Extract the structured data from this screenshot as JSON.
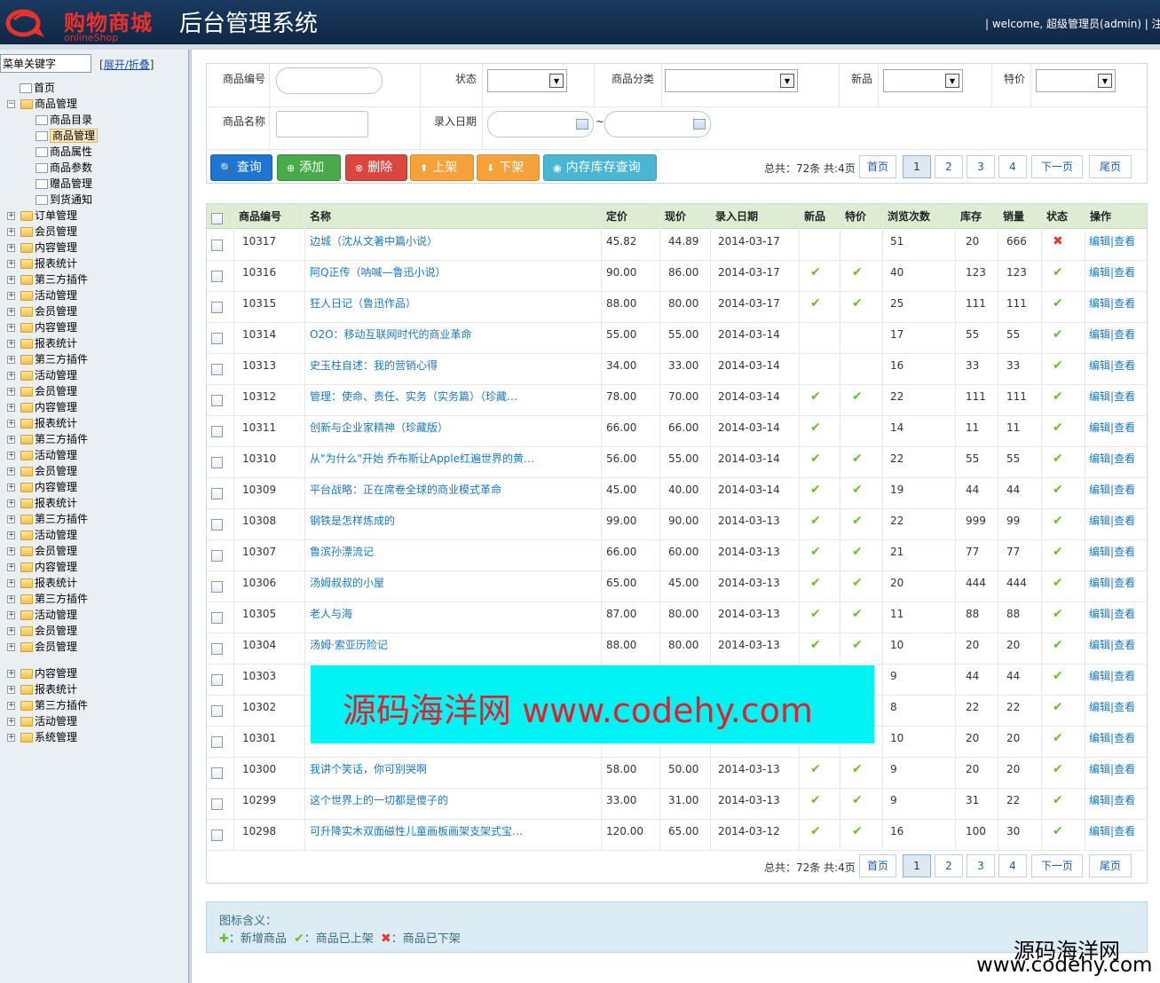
{
  "header": {
    "logo_text": "购物商城",
    "logo_sub": "onlineShop",
    "title": "后台管理系统",
    "welcome": "| welcome, 超级管理员(admin) | 注销"
  },
  "sidebar": {
    "search_value": "菜单关键字",
    "toggle_label": "展开/折叠",
    "items": [
      {
        "label": "首页",
        "type": "page",
        "level": 1
      },
      {
        "label": "商品管理",
        "type": "folder",
        "level": 0,
        "expanded": true
      },
      {
        "label": "商品目录",
        "type": "page",
        "level": 2
      },
      {
        "label": "商品管理",
        "type": "page",
        "level": 2,
        "selected": true
      },
      {
        "label": "商品属性",
        "type": "page",
        "level": 2
      },
      {
        "label": "商品参数",
        "type": "page",
        "level": 2
      },
      {
        "label": "赠品管理",
        "type": "page",
        "level": 2
      },
      {
        "label": "到货通知",
        "type": "page",
        "level": 2
      },
      {
        "label": "订单管理",
        "type": "folder",
        "level": 0
      },
      {
        "label": "会员管理",
        "type": "folder",
        "level": 0
      },
      {
        "label": "内容管理",
        "type": "folder",
        "level": 0
      },
      {
        "label": "报表统计",
        "type": "folder",
        "level": 0
      },
      {
        "label": "第三方插件",
        "type": "folder",
        "level": 0
      },
      {
        "label": "活动管理",
        "type": "folder",
        "level": 0
      },
      {
        "label": "会员管理",
        "type": "folder",
        "level": 0
      },
      {
        "label": "内容管理",
        "type": "folder",
        "level": 0
      },
      {
        "label": "报表统计",
        "type": "folder",
        "level": 0
      },
      {
        "label": "第三方插件",
        "type": "folder",
        "level": 0
      },
      {
        "label": "活动管理",
        "type": "folder",
        "level": 0
      },
      {
        "label": "会员管理",
        "type": "folder",
        "level": 0
      },
      {
        "label": "内容管理",
        "type": "folder",
        "level": 0
      },
      {
        "label": "报表统计",
        "type": "folder",
        "level": 0
      },
      {
        "label": "第三方插件",
        "type": "folder",
        "level": 0
      },
      {
        "label": "活动管理",
        "type": "folder",
        "level": 0
      },
      {
        "label": "会员管理",
        "type": "folder",
        "level": 0
      },
      {
        "label": "内容管理",
        "type": "folder",
        "level": 0
      },
      {
        "label": "报表统计",
        "type": "folder",
        "level": 0
      },
      {
        "label": "第三方插件",
        "type": "folder",
        "level": 0
      },
      {
        "label": "活动管理",
        "type": "folder",
        "level": 0
      },
      {
        "label": "会员管理",
        "type": "folder",
        "level": 0
      },
      {
        "label": "内容管理",
        "type": "folder",
        "level": 0
      },
      {
        "label": "报表统计",
        "type": "folder",
        "level": 0
      },
      {
        "label": "第三方插件",
        "type": "folder",
        "level": 0
      },
      {
        "label": "活动管理",
        "type": "folder",
        "level": 0
      },
      {
        "label": "会员管理",
        "type": "folder",
        "level": 0
      },
      {
        "label": "会员管理",
        "type": "folder",
        "level": 0
      },
      {
        "label": "内容管理",
        "type": "folder",
        "level": 0
      },
      {
        "label": "报表统计",
        "type": "folder",
        "level": 0
      },
      {
        "label": "第三方插件",
        "type": "folder",
        "level": 0
      },
      {
        "label": "活动管理",
        "type": "folder",
        "level": 0
      },
      {
        "label": "系统管理",
        "type": "folder",
        "level": 0
      }
    ]
  },
  "filter": {
    "code_label": "商品编号",
    "status_label": "状态",
    "category_label": "商品分类",
    "new_label": "新品",
    "special_label": "特价",
    "name_label": "商品名称",
    "date_label": "录入日期",
    "date_sep": "~"
  },
  "toolbar": {
    "query": "查询",
    "add": "添加",
    "delete": "删除",
    "shelf_up": "上架",
    "shelf_down": "下架",
    "stock_query": "内存库存查询"
  },
  "pager": {
    "total": "总共：72条 共:4页",
    "first": "首页",
    "pages": [
      "1",
      "2",
      "3",
      "4"
    ],
    "current": "1",
    "next": "下一页",
    "last": "尾页"
  },
  "table": {
    "headers": [
      "商品编号",
      "名称",
      "定价",
      "现价",
      "录入日期",
      "新品",
      "特价",
      "浏览次数",
      "库存",
      "销量",
      "状态",
      "操作"
    ],
    "edit_label": "编辑",
    "view_label": "查看",
    "op_sep": "|",
    "rows": [
      {
        "id": "10317",
        "name": "边城（沈从文著中篇小说）",
        "price": "45.82",
        "now": "44.89",
        "date": "2014-03-17",
        "new": false,
        "special": false,
        "views": "51",
        "stock": "20",
        "sales": "666",
        "status": "off"
      },
      {
        "id": "10316",
        "name": "阿Q正传（呐喊—鲁迅小说）",
        "price": "90.00",
        "now": "86.00",
        "date": "2014-03-17",
        "new": true,
        "special": true,
        "views": "40",
        "stock": "123",
        "sales": "123",
        "status": "on"
      },
      {
        "id": "10315",
        "name": "狂人日记（鲁迅作品）",
        "price": "88.00",
        "now": "80.00",
        "date": "2014-03-17",
        "new": true,
        "special": true,
        "views": "25",
        "stock": "111",
        "sales": "111",
        "status": "on"
      },
      {
        "id": "10314",
        "name": "O2O：移动互联网时代的商业革命",
        "price": "55.00",
        "now": "55.00",
        "date": "2014-03-14",
        "new": false,
        "special": false,
        "views": "17",
        "stock": "55",
        "sales": "55",
        "status": "on"
      },
      {
        "id": "10313",
        "name": "史玉柱自述：我的营销心得",
        "price": "34.00",
        "now": "33.00",
        "date": "2014-03-14",
        "new": false,
        "special": false,
        "views": "16",
        "stock": "33",
        "sales": "33",
        "status": "on"
      },
      {
        "id": "10312",
        "name": "管理：使命、责任、实务（实务篇）（珍藏…",
        "price": "78.00",
        "now": "70.00",
        "date": "2014-03-14",
        "new": true,
        "special": true,
        "views": "22",
        "stock": "111",
        "sales": "111",
        "status": "on"
      },
      {
        "id": "10311",
        "name": "创新与企业家精神（珍藏版）",
        "price": "66.00",
        "now": "66.00",
        "date": "2014-03-14",
        "new": true,
        "special": false,
        "views": "14",
        "stock": "11",
        "sales": "11",
        "status": "on"
      },
      {
        "id": "10310",
        "name": "从\"为什么\"开始 乔布斯让Apple红遍世界的黄…",
        "price": "56.00",
        "now": "55.00",
        "date": "2014-03-14",
        "new": true,
        "special": true,
        "views": "22",
        "stock": "55",
        "sales": "55",
        "status": "on"
      },
      {
        "id": "10309",
        "name": "平台战略：正在席卷全球的商业模式革命",
        "price": "45.00",
        "now": "40.00",
        "date": "2014-03-14",
        "new": true,
        "special": true,
        "views": "19",
        "stock": "44",
        "sales": "44",
        "status": "on"
      },
      {
        "id": "10308",
        "name": "钢铁是怎样炼成的",
        "price": "99.00",
        "now": "90.00",
        "date": "2014-03-13",
        "new": true,
        "special": true,
        "views": "22",
        "stock": "999",
        "sales": "99",
        "status": "on"
      },
      {
        "id": "10307",
        "name": "鲁滨孙漂流记",
        "price": "66.00",
        "now": "60.00",
        "date": "2014-03-13",
        "new": true,
        "special": true,
        "views": "21",
        "stock": "77",
        "sales": "77",
        "status": "on"
      },
      {
        "id": "10306",
        "name": "汤姆叔叔的小屋",
        "price": "65.00",
        "now": "45.00",
        "date": "2014-03-13",
        "new": true,
        "special": true,
        "views": "20",
        "stock": "444",
        "sales": "444",
        "status": "on"
      },
      {
        "id": "10305",
        "name": "老人与海",
        "price": "87.00",
        "now": "80.00",
        "date": "2014-03-13",
        "new": true,
        "special": true,
        "views": "11",
        "stock": "88",
        "sales": "88",
        "status": "on"
      },
      {
        "id": "10304",
        "name": "汤姆·索亚历险记",
        "price": "88.00",
        "now": "80.00",
        "date": "2014-03-13",
        "new": true,
        "special": true,
        "views": "10",
        "stock": "20",
        "sales": "20",
        "status": "on"
      },
      {
        "id": "10303",
        "name": "",
        "price": "",
        "now": "",
        "date": "",
        "new": false,
        "special": false,
        "views": "9",
        "stock": "44",
        "sales": "44",
        "status": "on"
      },
      {
        "id": "10302",
        "name": "",
        "price": "",
        "now": "",
        "date": "",
        "new": false,
        "special": false,
        "views": "8",
        "stock": "22",
        "sales": "22",
        "status": "on"
      },
      {
        "id": "10301",
        "name": "",
        "price": "",
        "now": "",
        "date": "",
        "new": false,
        "special": false,
        "views": "10",
        "stock": "20",
        "sales": "20",
        "status": "on"
      },
      {
        "id": "10300",
        "name": "我讲个笑话，你可别哭啊",
        "price": "58.00",
        "now": "50.00",
        "date": "2014-03-13",
        "new": true,
        "special": true,
        "views": "9",
        "stock": "20",
        "sales": "20",
        "status": "on"
      },
      {
        "id": "10299",
        "name": "这个世界上的一切都是傻子的",
        "price": "33.00",
        "now": "31.00",
        "date": "2014-03-13",
        "new": true,
        "special": true,
        "views": "9",
        "stock": "31",
        "sales": "22",
        "status": "on"
      },
      {
        "id": "10298",
        "name": "可升降实木双面磁性儿童画板画架支架式宝…",
        "price": "120.00",
        "now": "65.00",
        "date": "2014-03-12",
        "new": true,
        "special": true,
        "views": "16",
        "stock": "100",
        "sales": "30",
        "status": "on"
      }
    ]
  },
  "legend": {
    "title": "图标含义：",
    "new_item": "：新增商品",
    "on_shelf": "：商品已上架",
    "off_shelf": "：商品已下架"
  },
  "watermark": {
    "center": "源码海洋网 www.codehy.com",
    "corner_cn": "源码海洋网",
    "corner_url": "www.codehy.com"
  },
  "colors": {
    "header_bg": "#14335a",
    "brand_red": "#e8322f",
    "table_header_bg": "#ddecd3",
    "link_blue": "#1a78bf",
    "check_green": "#6bbf2a",
    "cross_red": "#e03a3a",
    "watermark_bg": "#00f4f4"
  }
}
